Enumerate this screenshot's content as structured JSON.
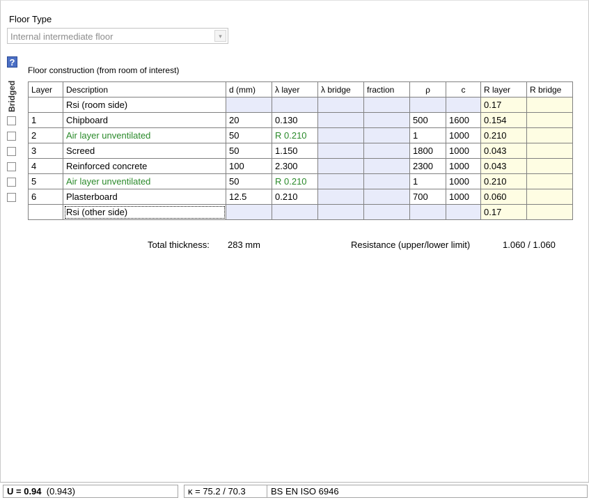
{
  "floor_type": {
    "label": "Floor Type",
    "selected": "Internal intermediate floor",
    "dropdown_arrow": "▾"
  },
  "help_icon": "?",
  "bridged_header": "Bridged",
  "construction_label": "Floor construction (from room of interest)",
  "columns": [
    "Layer",
    "Description",
    "d (mm)",
    "λ layer",
    "λ bridge",
    "fraction",
    "ρ",
    "c",
    "R layer",
    "R bridge"
  ],
  "rows": [
    {
      "layer": "",
      "desc": "Rsi (room side)",
      "d": "",
      "lambda": "",
      "bridge": "",
      "fraction": "",
      "rho": "",
      "c": "",
      "r_layer": "0.17",
      "r_bridge": "",
      "kind": "surface"
    },
    {
      "layer": "1",
      "desc": "Chipboard",
      "d": "20",
      "lambda": "0.130",
      "bridge": "",
      "fraction": "",
      "rho": "500",
      "c": "1600",
      "r_layer": "0.154",
      "r_bridge": "",
      "kind": "normal"
    },
    {
      "layer": "2",
      "desc": "Air layer unventilated",
      "d": "50",
      "lambda": "R 0.210",
      "bridge": "",
      "fraction": "",
      "rho": "1",
      "c": "1000",
      "r_layer": "0.210",
      "r_bridge": "",
      "kind": "air"
    },
    {
      "layer": "3",
      "desc": "Screed",
      "d": "50",
      "lambda": "1.150",
      "bridge": "",
      "fraction": "",
      "rho": "1800",
      "c": "1000",
      "r_layer": "0.043",
      "r_bridge": "",
      "kind": "normal"
    },
    {
      "layer": "4",
      "desc": "Reinforced concrete",
      "d": "100",
      "lambda": "2.300",
      "bridge": "",
      "fraction": "",
      "rho": "2300",
      "c": "1000",
      "r_layer": "0.043",
      "r_bridge": "",
      "kind": "normal"
    },
    {
      "layer": "5",
      "desc": "Air layer unventilated",
      "d": "50",
      "lambda": "R 0.210",
      "bridge": "",
      "fraction": "",
      "rho": "1",
      "c": "1000",
      "r_layer": "0.210",
      "r_bridge": "",
      "kind": "air"
    },
    {
      "layer": "6",
      "desc": "Plasterboard",
      "d": "12.5",
      "lambda": "0.210",
      "bridge": "",
      "fraction": "",
      "rho": "700",
      "c": "1000",
      "r_layer": "0.060",
      "r_bridge": "",
      "kind": "normal"
    },
    {
      "layer": "",
      "desc": "Rsi (other side)",
      "d": "",
      "lambda": "",
      "bridge": "",
      "fraction": "",
      "rho": "",
      "c": "",
      "r_layer": "0.17",
      "r_bridge": "",
      "kind": "surface"
    }
  ],
  "summary": {
    "thickness_label": "Total thickness:",
    "thickness_value": "283 mm",
    "resistance_label": "Resistance (upper/lower limit)",
    "resistance_value": "1.060 / 1.060"
  },
  "status": {
    "u_label": "U = ",
    "u_value": "0.94",
    "u_precise": "(0.943)",
    "kappa": "κ = 75.2 / 70.3",
    "standard": "BS EN ISO 6946"
  },
  "colors": {
    "air_text": "#2a8a2a",
    "blue_cell": "#e8ebfa",
    "yellow_cell": "#fefde3",
    "help_icon_bg": "#4b6fc4"
  }
}
